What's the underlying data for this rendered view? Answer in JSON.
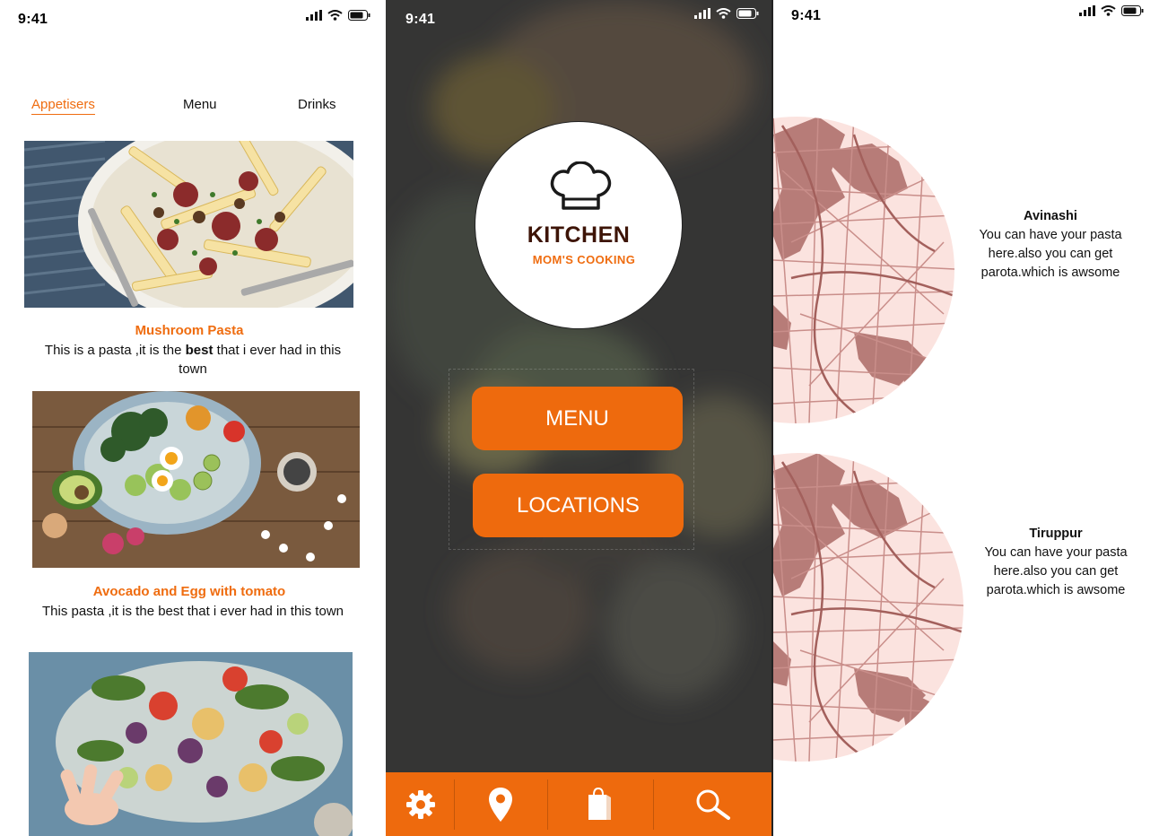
{
  "status_bar": {
    "time": "9:41"
  },
  "screen_list": {
    "tabs": [
      "Appetisers",
      "Menu",
      "Drinks"
    ],
    "active_tab": "Appetisers",
    "items": [
      {
        "title": "Mushroom Pasta",
        "desc_before": "This is a pasta ,it is the ",
        "desc_bold": "best",
        "desc_after": " that i ever had in this town"
      },
      {
        "title": "Avocado and Egg with tomato",
        "desc": "This  pasta ,it is the best that i ever had in this town"
      }
    ]
  },
  "screen_home": {
    "brand": "KITCHEN",
    "tagline": "MOM'S COOKING",
    "menu_label": "MENU",
    "locations_label": "LOCATIONS",
    "nav_icons": [
      "gear-icon",
      "location-pin-icon",
      "shopping-bag-icon",
      "search-icon"
    ],
    "accent": "#ee6a0d"
  },
  "screen_locations": {
    "locations": [
      {
        "name": "Avinashi",
        "desc": "You can have your pasta here.also you can get parota.which is awsome"
      },
      {
        "name": "Tiruppur",
        "desc": "You can have your pasta here.also you can get parota.which is awsome"
      }
    ],
    "map_color": "#fbe3df",
    "road_color": "#c98e8a"
  }
}
